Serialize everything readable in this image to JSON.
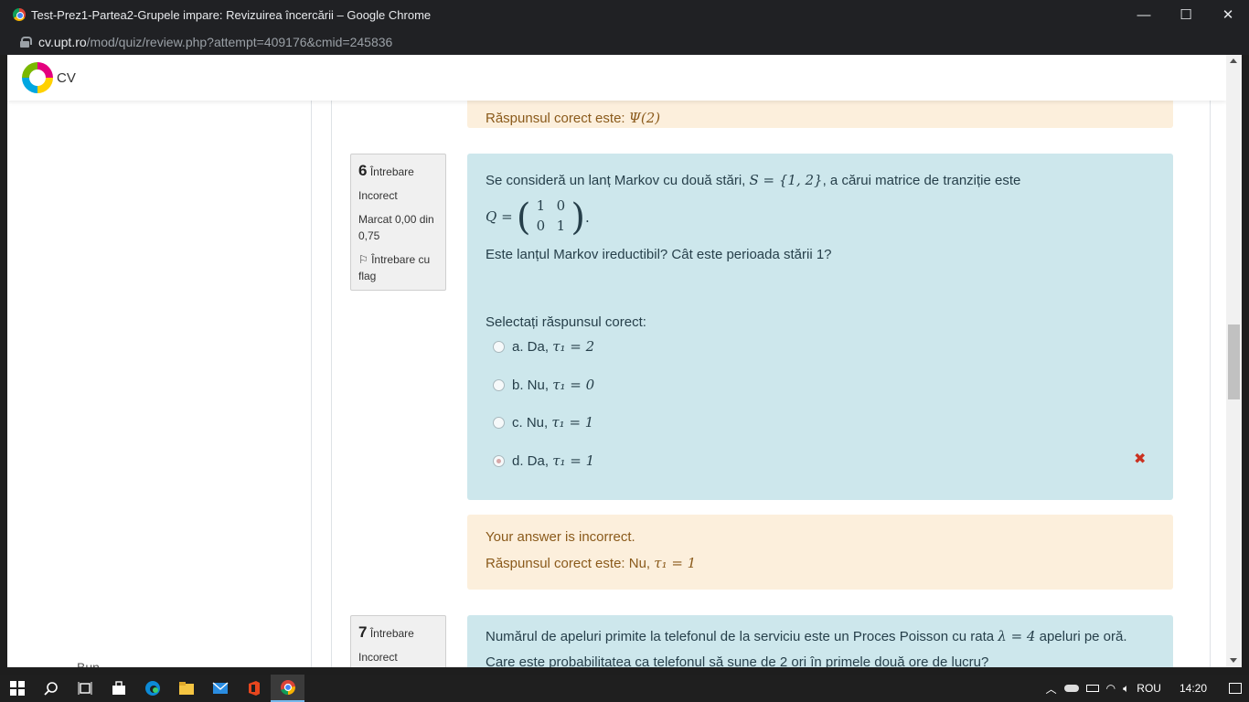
{
  "window": {
    "title": "Test-Prez1-Partea2-Grupele impare: Revizuirea încercării – Google Chrome",
    "minimize": "—",
    "maximize": "☐",
    "close": "✕"
  },
  "address": {
    "host": "cv.upt.ro",
    "path": "/mod/quiz/review.php?attempt=409176&cmid=245836"
  },
  "site": {
    "brand": "CV"
  },
  "prev_feedback": {
    "correct_text": "Răspunsul corect este:",
    "correct_math": "Ψ(2)"
  },
  "q6": {
    "number": "6",
    "word": "Întrebare",
    "state": "Incorect",
    "grade": "Marcat 0,00 din 0,75",
    "flag": "Întrebare cu flag",
    "text_1": "Se consideră un lanț Markov cu două stări,",
    "text_1_math": "S = {1, 2}",
    "text_1_end": ", a cărui matrice de tranziție este",
    "matrix_lhs": "Q =",
    "matrix": [
      "1",
      "0",
      "0",
      "1"
    ],
    "matrix_end": ".",
    "text_2": "Este lanțul Markov ireductibil?  Cât este perioada stării 1?",
    "prompt": "Selectați răspunsul corect:",
    "options": [
      {
        "label": "a. Da,",
        "math": "τ₁ = 2",
        "checked": false
      },
      {
        "label": "b. Nu,",
        "math": "τ₁ = 0",
        "checked": false
      },
      {
        "label": "c. Nu,",
        "math": "τ₁ = 1",
        "checked": false
      },
      {
        "label": "d. Da,",
        "math": "τ₁ = 1",
        "checked": true
      }
    ],
    "wrong_mark": "✖",
    "feedback_1": "Your answer is incorrect.",
    "feedback_2": "Răspunsul corect este: Nu,",
    "feedback_2_math": "τ₁ = 1"
  },
  "q7": {
    "number": "7",
    "word": "Întrebare",
    "state": "Incorect",
    "text_1": "Numărul de apeluri primite la telefonul de la serviciu este un Proces Poisson cu rata",
    "text_1_math": "λ = 4",
    "text_1_end": "apeluri pe oră.",
    "text_2": "Care este probabilitatea ca telefonul să sune de 2 ori în primele două ore de lucru?"
  },
  "sidebar": {
    "bottom_text": "Bun"
  },
  "taskbar": {
    "lang": "ROU",
    "time": "14:20"
  },
  "colors": {
    "formulation": "#cde7ec",
    "feedback": "#fcefdc",
    "wrong": "#ca3120"
  }
}
